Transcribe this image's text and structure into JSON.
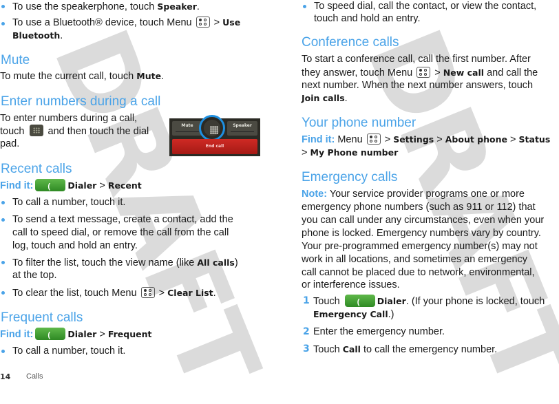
{
  "left": {
    "intro_bullets": [
      {
        "pre": "To use the speakerphone, touch ",
        "bold": "Speaker",
        "post": "."
      },
      {
        "pre": "To use a Bluetooth® device, touch Menu ",
        "sep": " > ",
        "bold": "Use",
        "bold2": "Bluetooth",
        "post": "."
      }
    ],
    "mute": {
      "heading": "Mute",
      "pre": "To mute the current call, touch ",
      "bold": "Mute",
      "post": "."
    },
    "enter_numbers": {
      "heading": "Enter numbers during a call",
      "line1": "To enter numbers during a call,",
      "line2_pre": "touch ",
      "line2_post": " and then touch the dial",
      "line3": "pad.",
      "screenshot": {
        "mute_label": "Mute",
        "speaker_label": "Speaker",
        "end_label": "End call"
      }
    },
    "recent": {
      "heading": "Recent calls",
      "find_it": "Find it:",
      "path": "Dialer",
      "sep": " > ",
      "path2": "Recent",
      "bullets": [
        {
          "lines": [
            "To call a number, touch it."
          ]
        },
        {
          "lines": [
            "To send a text message, create a contact, add the",
            "call to speed dial, or remove the call from the call",
            "log, touch and hold an entry."
          ]
        },
        {
          "pre": "To filter the list, touch the view name (like ",
          "bold": "All calls",
          "post": ")",
          "line2": "at the top."
        },
        {
          "pre": "To clear the list, touch Menu ",
          "sep": " > ",
          "bold": "Clear List",
          "post": "."
        }
      ]
    },
    "frequent": {
      "heading": "Frequent calls",
      "find_it": "Find it:",
      "path": "Dialer",
      "sep": " > ",
      "path2": "Frequent",
      "bullet": "To call a number, touch it."
    }
  },
  "right": {
    "top_bullet": [
      "To speed dial, call the contact, or view the contact,",
      "touch and hold an entry."
    ],
    "conference": {
      "heading": "Conference calls",
      "line1": "To start a conference call, call the first number. After",
      "line2_pre": "they answer, touch Menu ",
      "line2_sep": " > ",
      "line2_bold": "New call",
      "line2_post": " and call the",
      "line3": "next number. When the next number answers, touch",
      "line4_bold": "Join calls",
      "line4_post": "."
    },
    "phone_number": {
      "heading": "Your phone number",
      "find_it": "Find it:",
      "menu": " Menu ",
      "sep": " > ",
      "p1": "Settings",
      "p2": "About phone",
      "p3": "Status",
      "p4": "My Phone number"
    },
    "emergency": {
      "heading": "Emergency calls",
      "note_label": "Note:",
      "note_lines": [
        " Your service provider programs one or more",
        "emergency phone numbers (such as 911 or 112) that",
        "you can call under any circumstances, even when your",
        "phone is locked. Emergency numbers vary by country.",
        "Your pre-programmed emergency number(s) may not",
        "work in all locations, and sometimes an emergency",
        "call cannot be placed due to network, environmental,",
        "or interference issues."
      ],
      "steps": [
        {
          "num": "1",
          "pre": "Touch ",
          "bold": "Dialer",
          "post": ". (If your phone is locked, touch",
          "line2_bold": "Emergency Call",
          "line2_post": ".)"
        },
        {
          "num": "2",
          "text": "Enter the emergency number."
        },
        {
          "num": "3",
          "pre": "Touch ",
          "bold": "Call",
          "post": " to call the emergency number."
        }
      ]
    }
  },
  "footer": {
    "page": "14",
    "section": "Calls"
  },
  "watermark": "DRAFT",
  "colors": {
    "heading": "#4aa3e8",
    "dialer_green": "#3c9a2c",
    "end_call_red": "#c0221d",
    "highlight_ring": "#1e8fe0"
  }
}
